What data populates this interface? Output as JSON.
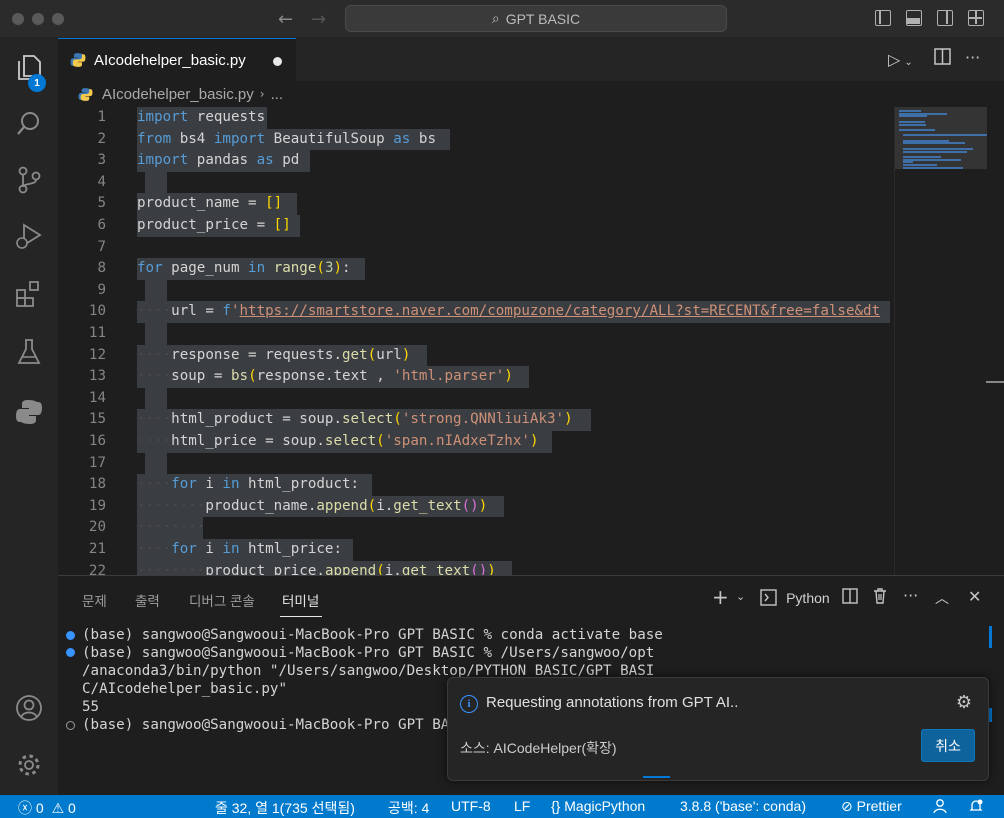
{
  "window": {
    "search_label": "GPT BASIC"
  },
  "activity": {
    "explorer_badge": "1"
  },
  "tab": {
    "filename": "AIcodehelper_basic.py"
  },
  "breadcrumb": {
    "file": "AIcodehelper_basic.py",
    "ellipsis": "..."
  },
  "editor": {
    "lines": [
      {
        "n": "1",
        "html": "<span class=\"kw\">import</span><span class=\"plain\"> requests</span>"
      },
      {
        "n": "2",
        "html": "<span class=\"kw\">from</span><span class=\"plain\"> bs4 </span><span class=\"kw\">import</span><span class=\"plain\"> BeautifulSoup </span><span class=\"kw\">as</span><span class=\"plain\"> bs</span>"
      },
      {
        "n": "3",
        "html": "<span class=\"kw\">import</span><span class=\"plain\"> pandas </span><span class=\"kw\">as</span><span class=\"plain\"> pd</span>"
      },
      {
        "n": "4",
        "html": ""
      },
      {
        "n": "5",
        "html": "<span class=\"plain\">product_name = </span><span class=\"br1\">[]</span>"
      },
      {
        "n": "6",
        "html": "<span class=\"plain\">product_price = </span><span class=\"br1\">[]</span>"
      },
      {
        "n": "7",
        "html": ""
      },
      {
        "n": "8",
        "html": "<span class=\"kw\">for</span><span class=\"plain\"> page_num </span><span class=\"kw\">in</span><span class=\"plain\"> </span><span class=\"fn\">range</span><span class=\"br1\">(</span><span class=\"num\">3</span><span class=\"br1\">)</span><span class=\"plain\">:</span>"
      },
      {
        "n": "9",
        "html": ""
      },
      {
        "n": "10",
        "html": "<span class=\"ws\">····</span><span class=\"plain\">url = </span><span class=\"kw\">f</span><span class=\"str\">'</span><span class=\"url\">https://smartstore.naver.com/compuzone/category/ALL?st=RECENT&amp;free=false&amp;dt</span>"
      },
      {
        "n": "11",
        "html": ""
      },
      {
        "n": "12",
        "html": "<span class=\"ws\">····</span><span class=\"plain\">response = requests.</span><span class=\"fn\">get</span><span class=\"br1\">(</span><span class=\"plain\">url</span><span class=\"br1\">)</span>"
      },
      {
        "n": "13",
        "html": "<span class=\"ws\">····</span><span class=\"plain\">soup = </span><span class=\"fn\">bs</span><span class=\"br1\">(</span><span class=\"plain\">response.text , </span><span class=\"str\">'html.parser'</span><span class=\"br1\">)</span>"
      },
      {
        "n": "14",
        "html": ""
      },
      {
        "n": "15",
        "html": "<span class=\"ws\">····</span><span class=\"plain\">html_product = soup.</span><span class=\"fn\">select</span><span class=\"br1\">(</span><span class=\"str\">'strong.QNNliuiAk3'</span><span class=\"br1\">)</span>"
      },
      {
        "n": "16",
        "html": "<span class=\"ws\">····</span><span class=\"plain\">html_price = soup.</span><span class=\"fn\">select</span><span class=\"br1\">(</span><span class=\"str\">'span.nIAdxeTzhx'</span><span class=\"br1\">)</span>"
      },
      {
        "n": "17",
        "html": ""
      },
      {
        "n": "18",
        "html": "<span class=\"ws\">····</span><span class=\"kw\">for</span><span class=\"plain\"> i </span><span class=\"kw\">in</span><span class=\"plain\"> html_product:</span>"
      },
      {
        "n": "19",
        "html": "<span class=\"ws\">········</span><span class=\"plain\">product_name.</span><span class=\"fn\">append</span><span class=\"br1\">(</span><span class=\"plain\">i.</span><span class=\"fn\">get_text</span><span class=\"br2\">()</span><span class=\"br1\">)</span>"
      },
      {
        "n": "20",
        "html": "<span class=\"ws\">········</span>"
      },
      {
        "n": "21",
        "html": "<span class=\"ws\">····</span><span class=\"kw\">for</span><span class=\"plain\"> i </span><span class=\"kw\">in</span><span class=\"plain\"> html_price:</span>"
      },
      {
        "n": "22",
        "html": "<span class=\"ws\">········</span><span class=\"plain\">product_price.</span><span class=\"fn\">append</span><span class=\"br1\">(</span><span class=\"plain\">i.</span><span class=\"fn\">get_text</span><span class=\"br2\">()</span><span class=\"br1\">)</span>"
      }
    ]
  },
  "panel": {
    "tabs": [
      "문제",
      "출력",
      "디버그 콘솔",
      "터미널"
    ],
    "shell_label": "Python",
    "terminal_lines": [
      "(base) sangwoo@Sangwooui-MacBook-Pro GPT BASIC % conda activate base",
      "(base) sangwoo@Sangwooui-MacBook-Pro GPT BASIC % /Users/sangwoo/opt",
      "/anaconda3/bin/python \"/Users/sangwoo/Desktop/PYTHON BASIC/GPT BASI",
      "C/AIcodehelper_basic.py\"",
      "55",
      "(base) sangwoo@Sangwooui-MacBook-Pro GPT BAS"
    ]
  },
  "notification": {
    "message": "Requesting annotations from GPT AI..",
    "source": "소스: AICodeHelper(확장)",
    "cancel_label": "취소"
  },
  "statusbar": {
    "errors": "0",
    "warnings": "0",
    "position": "줄 32, 열 1(735 선택됨)",
    "spaces": "공백: 4",
    "encoding": "UTF-8",
    "eol": "LF",
    "language": "MagicPython",
    "interpreter": "3.8.8 ('base': conda)",
    "prettier": "Prettier"
  }
}
